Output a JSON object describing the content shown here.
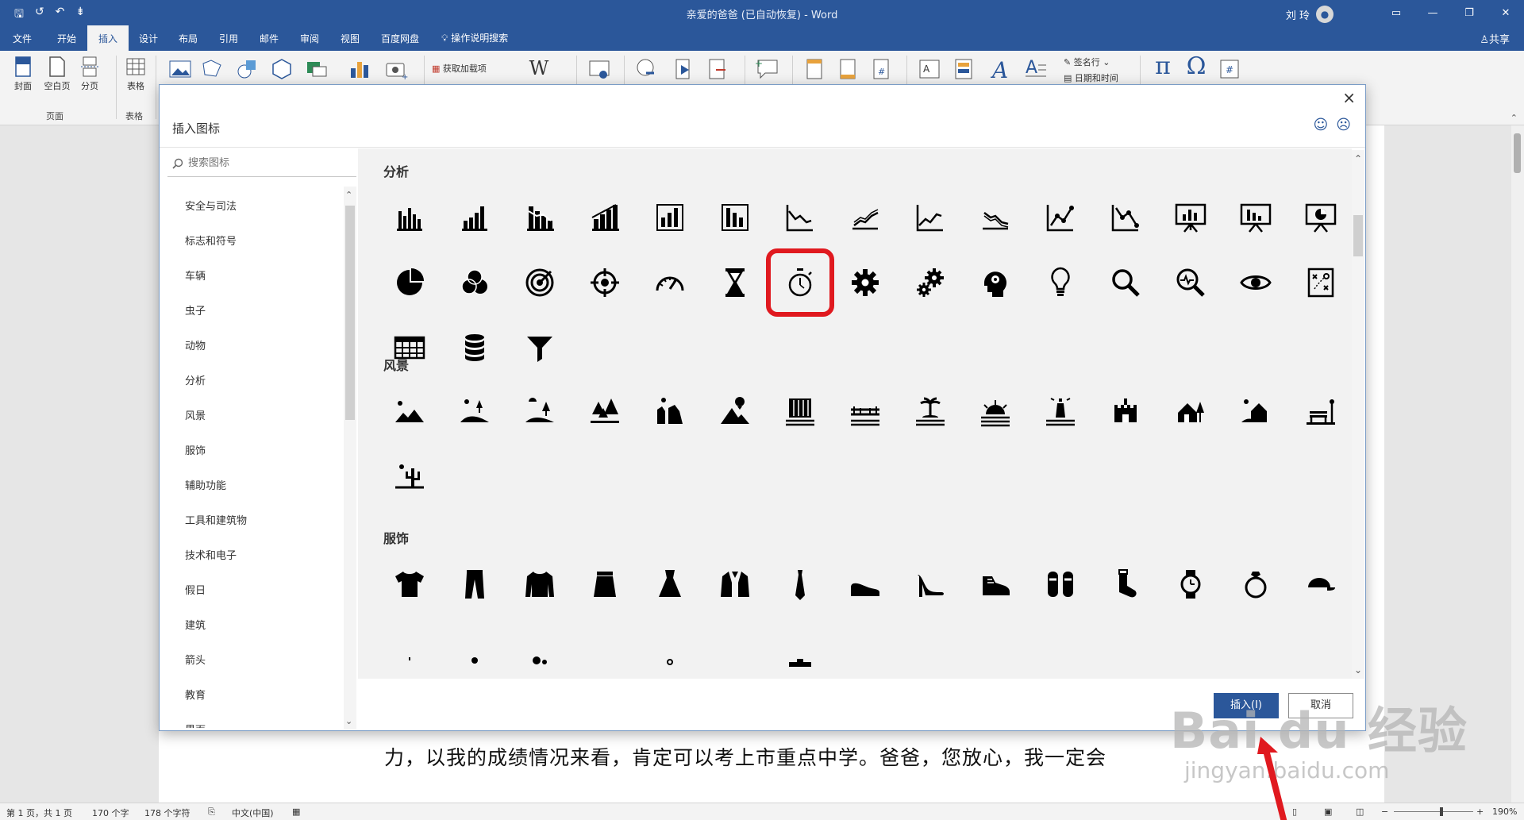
{
  "titlebar": {
    "document_title": "亲爱的爸爸 (已自动恢复)  -  Word",
    "user_name": "刘 玲",
    "qa_save": "🖫",
    "qa_redo": "↺",
    "qa_undo": "↶",
    "qa_custom": "⇟"
  },
  "ribbon_tabs": [
    "文件",
    "开始",
    "插入",
    "设计",
    "布局",
    "引用",
    "邮件",
    "审阅",
    "视图",
    "百度网盘"
  ],
  "active_tab": "插入",
  "tell_me": "操作说明搜索",
  "share": "共享",
  "ribbon": {
    "cover_page": "封面",
    "blank_page": "空白页",
    "page_break": "分页",
    "pages_group": "页面",
    "table": "表格",
    "tables_group": "表格",
    "get_addins": "获取加载项",
    "wikipedia": "W",
    "signature_line": "签名行",
    "date_time": "日期和时间",
    "equation": "π",
    "symbol": "Ω"
  },
  "dialog": {
    "title": "插入图标",
    "close": "×",
    "feedback_smile": "☺",
    "feedback_frown": "☹",
    "search_placeholder": "搜索图标",
    "categories": [
      "安全与司法",
      "标志和符号",
      "车辆",
      "虫子",
      "动物",
      "分析",
      "风景",
      "服饰",
      "辅助功能",
      "工具和建筑物",
      "技术和电子",
      "假日",
      "建筑",
      "箭头",
      "教育",
      "界面"
    ],
    "sections": {
      "analysis": "分析",
      "landscape": "风景",
      "apparel": "服饰"
    },
    "selected_icon": "stopwatch-icon",
    "insert_button": "插入(I)",
    "cancel_button": "取消"
  },
  "document": {
    "visible_line": "力，以我的成绩情况来看，肯定可以考上市重点中学。爸爸，您放心，我一定会"
  },
  "statusbar": {
    "page": "第 1 页，共 1 页",
    "words": "170 个字",
    "chars": "178 个字符",
    "language": "中文(中国)",
    "zoom": "190%"
  },
  "watermark": {
    "brand": "Bai du 经验",
    "url": "jingyan.baidu.com"
  },
  "colors": {
    "word_blue": "#2b579a",
    "highlight_red": "#e0191f"
  }
}
